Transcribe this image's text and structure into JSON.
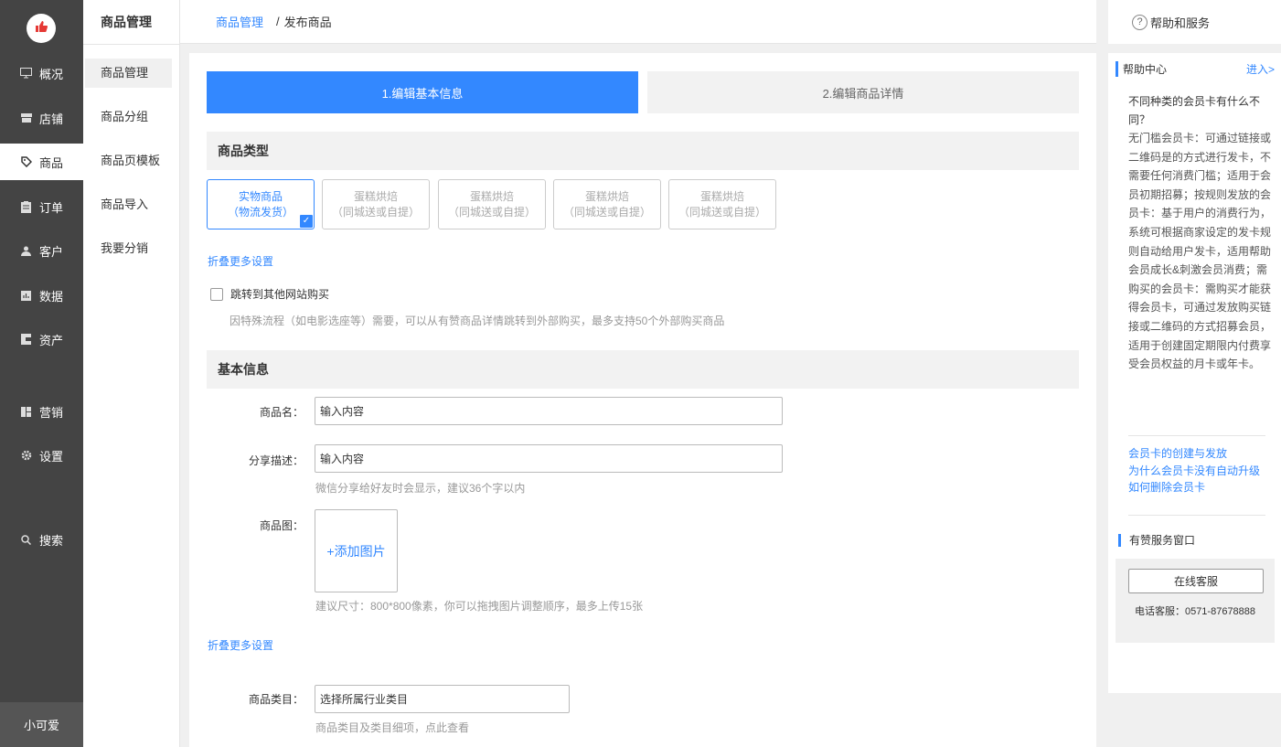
{
  "nav": {
    "items": [
      {
        "label": "概况",
        "icon": "monitor-icon"
      },
      {
        "label": "店铺",
        "icon": "store-icon"
      },
      {
        "label": "商品",
        "icon": "tag-icon"
      },
      {
        "label": "订单",
        "icon": "clipboard-icon"
      },
      {
        "label": "客户",
        "icon": "user-icon"
      },
      {
        "label": "数据",
        "icon": "chart-icon"
      },
      {
        "label": "资产",
        "icon": "wallet-icon"
      },
      {
        "label": "营销",
        "icon": "grid-icon"
      },
      {
        "label": "设置",
        "icon": "gear-icon"
      },
      {
        "label": "搜索",
        "icon": "search-icon"
      }
    ],
    "user": "小可爱"
  },
  "subnav": {
    "title": "商品管理",
    "items": [
      "商品管理",
      "商品分组",
      "商品页模板",
      "商品导入",
      "我要分销"
    ]
  },
  "breadcrumb": {
    "parent": "商品管理",
    "current": "发布商品"
  },
  "steps": {
    "step1": "1.编辑基本信息",
    "step2": "2.编辑商品详情"
  },
  "product_type": {
    "heading": "商品类型",
    "cards": [
      {
        "line1": "实物商品",
        "line2": "（物流发货）"
      },
      {
        "line1": "蛋糕烘焙",
        "line2": "（同城送或自提）"
      },
      {
        "line1": "蛋糕烘焙",
        "line2": "（同城送或自提）"
      },
      {
        "line1": "蛋糕烘焙",
        "line2": "（同城送或自提）"
      },
      {
        "line1": "蛋糕烘焙",
        "line2": "（同城送或自提）"
      }
    ],
    "collapse_link": "折叠更多设置",
    "redirect_label": "跳转到其他网站购买",
    "redirect_hint": "因特殊流程（如电影选座等）需要，可以从有赞商品详情跳转到外部购买，最多支持50个外部购买商品"
  },
  "basic_info": {
    "heading": "基本信息",
    "name_label": "商品名：",
    "name_value": "输入内容",
    "share_label": "分享描述：",
    "share_value": "输入内容",
    "share_hint": "微信分享给好友时会显示，建议36个字以内",
    "image_label": "商品图：",
    "image_add": "+添加图片",
    "image_hint": "建议尺寸：800*800像素，你可以拖拽图片调整顺序，最多上传15张",
    "collapse_link": "折叠更多设置",
    "category_label": "商品类目：",
    "category_value": "选择所属行业类目",
    "category_hint": "商品类目及类目细项，点此查看"
  },
  "help": {
    "top_title": "帮助和服务",
    "center_title": "帮助中心",
    "enter": "进入>",
    "question": "不同种类的会员卡有什么不同？",
    "answer": "无门槛会员卡：可通过链接或二维码是的方式进行发卡，不需要任何消费门槛；适用于会员初期招募；按规则发放的会员卡：基于用户的消费行为，系统可根据商家设定的发卡规则自动给用户发卡，适用帮助会员成长&刺激会员消费；需购买的会员卡：需购买才能获得会员卡，可通过发放购买链接或二维码的方式招募会员，适用于创建固定期限内付费享受会员权益的月卡或年卡。",
    "links": [
      "会员卡的创建与发放",
      "为什么会员卡没有自动升级",
      "如何删除会员卡"
    ],
    "service_title": "有赞服务窗口",
    "service_button": "在线客服",
    "service_phone": "电话客服：0571-87678888"
  },
  "colors": {
    "accent": "#3388ff",
    "sidebar": "#444444"
  }
}
